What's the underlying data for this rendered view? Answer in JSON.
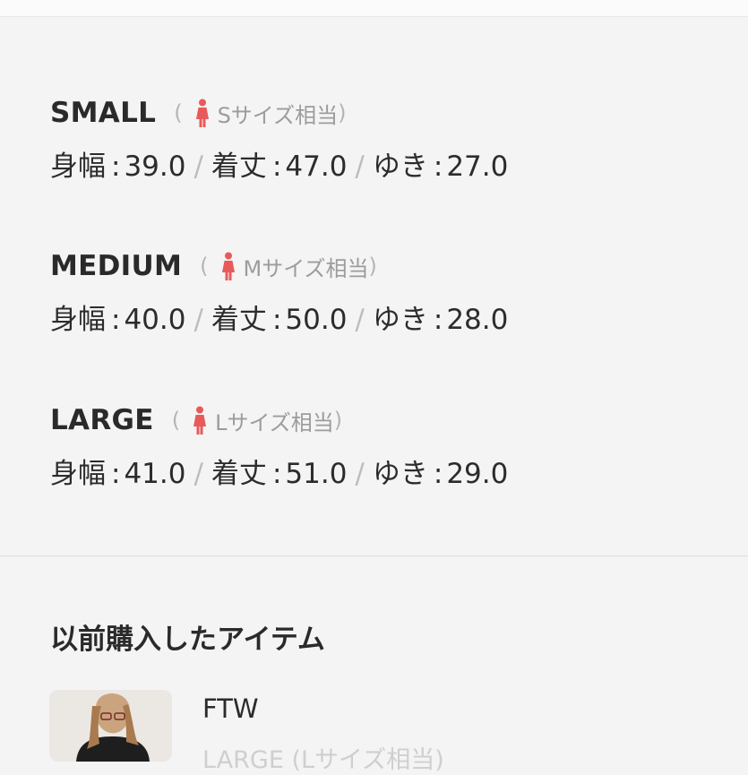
{
  "sizes": [
    {
      "name": "SMALL",
      "note": "Sサイズ相当",
      "width_label": "身幅",
      "width_value": "39.0",
      "length_label": "着丈",
      "length_value": "47.0",
      "sleeve_label": "ゆき",
      "sleeve_value": "27.0"
    },
    {
      "name": "MEDIUM",
      "note": "Mサイズ相当",
      "width_label": "身幅",
      "width_value": "40.0",
      "length_label": "着丈",
      "length_value": "50.0",
      "sleeve_label": "ゆき",
      "sleeve_value": "28.0"
    },
    {
      "name": "LARGE",
      "note": "Lサイズ相当",
      "width_label": "身幅",
      "width_value": "41.0",
      "length_label": "着丈",
      "length_value": "51.0",
      "sleeve_label": "ゆき",
      "sleeve_value": "29.0"
    }
  ],
  "history": {
    "title": "以前購入したアイテム",
    "item": {
      "name": "FTW",
      "size_partial": "LARGE (Lサイズ相当)"
    }
  },
  "colors": {
    "accent_person": "#e85a5a",
    "text": "#2b2b2b",
    "muted": "#9c9c9c"
  },
  "icons": {
    "size_note": "person-icon"
  }
}
